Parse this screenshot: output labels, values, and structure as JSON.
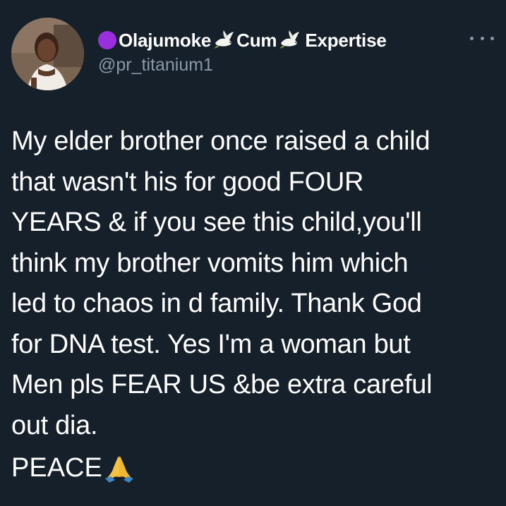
{
  "tweet": {
    "author": {
      "name_prefix_emoji": "purple-circle",
      "name_part1": "Olajumoke",
      "name_part2": "Cum",
      "name_part3": "Expertise",
      "separator_emoji": "dove",
      "handle": "@pr_titanium1",
      "avatar": "profile-photo"
    },
    "more_icon": "more-horizontal-icon",
    "body_lines": [
      "My elder brother once raised a child",
      "that wasn't his for good FOUR",
      "YEARS & if you see this child,you'll",
      "think my brother vomits him which",
      "led to chaos in d family. Thank God",
      "for DNA test. Yes I'm a woman but",
      "Men pls FEAR US &be extra careful",
      "out dia."
    ],
    "closing": "PEACE",
    "closing_emoji": "folded-hands"
  },
  "colors": {
    "background": "#15202b",
    "text": "#ffffff",
    "secondary_text": "#8b98a5",
    "purple_circle": "#9b2fe0"
  }
}
